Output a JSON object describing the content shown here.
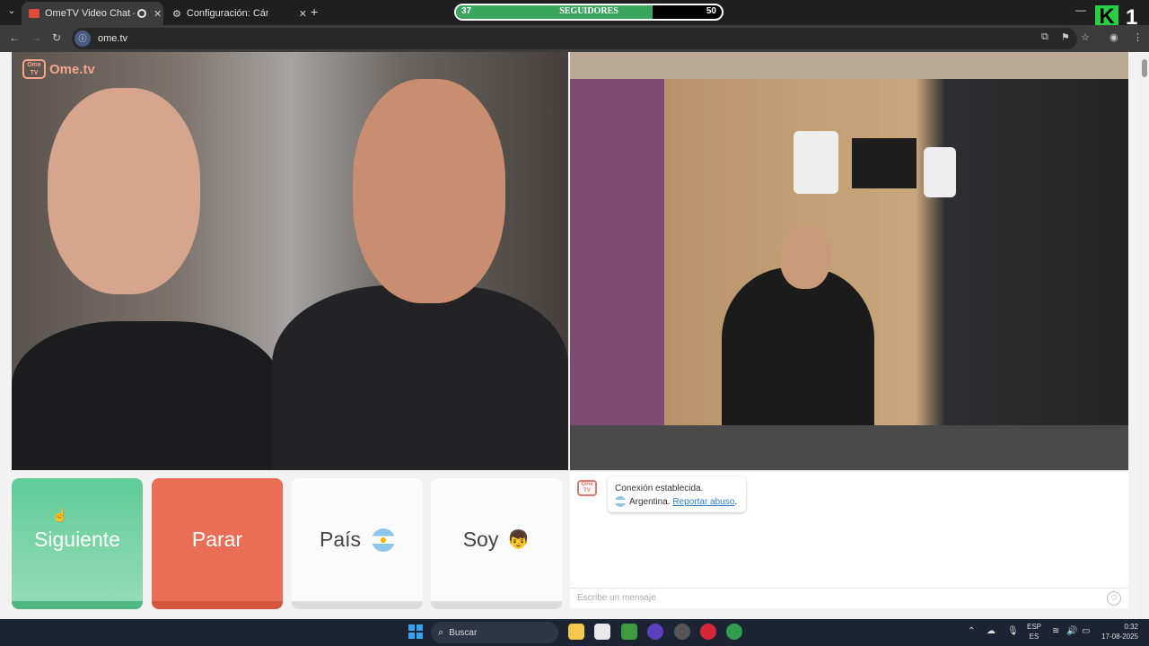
{
  "browser": {
    "tabs": [
      {
        "title": "OmeTV Video Chat — Ome",
        "active": true
      },
      {
        "title": "Configuración: Cámara",
        "active": false
      }
    ],
    "url": "ome.tv"
  },
  "overlay": {
    "followers_label": "SEGUIDORES",
    "followers_current": "37",
    "followers_goal": "50",
    "followers_progress": 0.74,
    "brand_letter": "K",
    "brand_number": "1"
  },
  "app": {
    "logo_box": "Ome TV",
    "logo_text": "Ome.tv",
    "buttons": {
      "next": "Siguiente",
      "stop": "Parar",
      "country": "País",
      "gender": "Soy",
      "gender_emoji": "👦"
    },
    "chat": {
      "status": "Conexión establecida.",
      "country": "Argentina.",
      "report_link": "Reportar abuso",
      "input_placeholder": "Escribe un mensaje"
    }
  },
  "taskbar": {
    "search_label": "Buscar",
    "lang_primary": "ESP",
    "lang_secondary": "ES",
    "time": "0:32",
    "date": "17-08-2025"
  },
  "colors": {
    "next": "#5fcc96",
    "stop": "#ea6d55",
    "followers_fill": "#3aa55c",
    "brand_green": "#29d046"
  }
}
